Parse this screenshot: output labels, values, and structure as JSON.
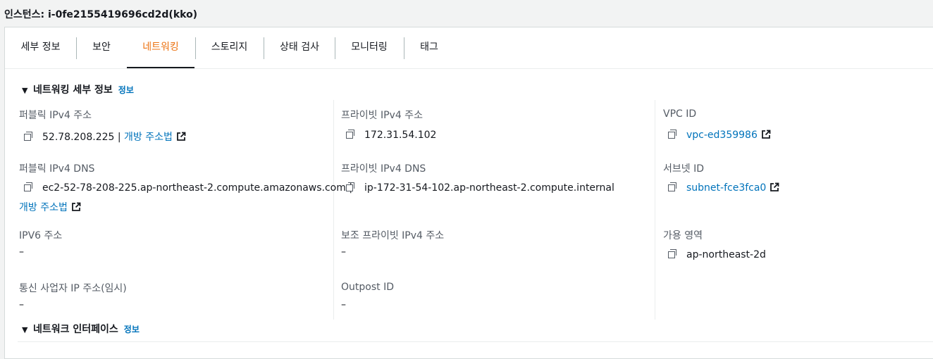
{
  "header": {
    "title": "인스턴스: i-0fe2155419696cd2d(kko)"
  },
  "tabs": [
    {
      "label": "세부 정보"
    },
    {
      "label": "보안"
    },
    {
      "label": "네트워킹",
      "active": true
    },
    {
      "label": "스토리지"
    },
    {
      "label": "상태 검사"
    },
    {
      "label": "모니터링"
    },
    {
      "label": "태그"
    }
  ],
  "networking_section": {
    "title": "네트워킹 세부 정보",
    "info": "정보"
  },
  "fields": {
    "public_ipv4": {
      "label": "퍼블릭 IPv4 주소",
      "value": "52.78.208.225 |",
      "link": "개방 주소법"
    },
    "private_ipv4": {
      "label": "프라이빗 IPv4 주소",
      "value": "172.31.54.102"
    },
    "vpc_id": {
      "label": "VPC ID",
      "link": "vpc-ed359986"
    },
    "public_dns": {
      "label": "퍼블릭 IPv4 DNS",
      "value": "ec2-52-78-208-225.ap-northeast-2.compute.amazonaws.com |",
      "link": "개방 주소법"
    },
    "private_dns": {
      "label": "프라이빗 IPv4 DNS",
      "value": "ip-172-31-54-102.ap-northeast-2.compute.internal"
    },
    "subnet_id": {
      "label": "서브넷 ID",
      "link": "subnet-fce3fca0"
    },
    "ipv6": {
      "label": "IPV6 주소",
      "value": "–"
    },
    "secondary_private": {
      "label": "보조 프라이빗 IPv4 주소",
      "value": "–"
    },
    "az": {
      "label": "가용 영역",
      "value": "ap-northeast-2d"
    },
    "carrier_ip": {
      "label": "통신 사업자 IP 주소(임시)",
      "value": "–"
    },
    "outpost_id": {
      "label": "Outpost ID",
      "value": "–"
    }
  },
  "interfaces_section": {
    "title": "네트워크 인터페이스",
    "info": "정보"
  },
  "colors": {
    "accent": "#ec7211",
    "link": "#0073bb",
    "text": "#16191f",
    "label": "#545b64"
  },
  "icons": {
    "copy": "copy-icon",
    "external": "external-link-icon",
    "caret": "caret-down-icon"
  }
}
